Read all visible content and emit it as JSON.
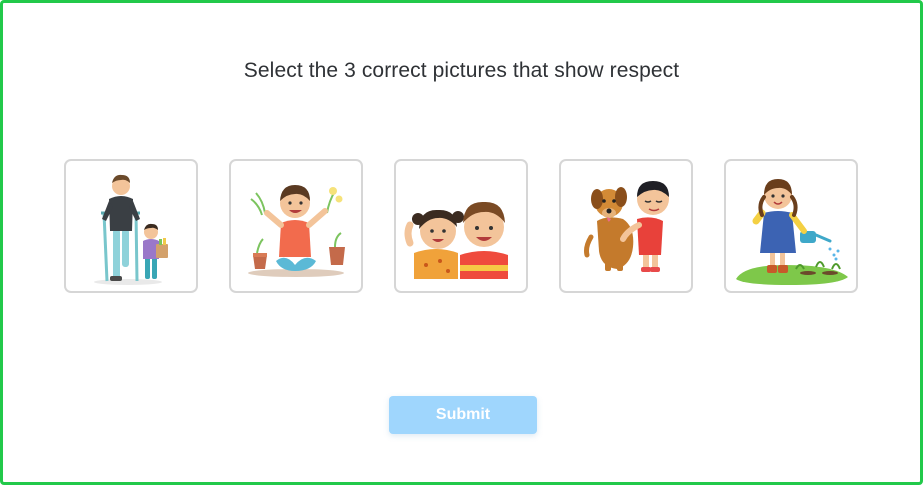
{
  "question": {
    "text": "Select the 3 correct pictures that show respect"
  },
  "choices": [
    {
      "id": "choice-1",
      "icon": "boy-helping-man-on-crutches-illustration"
    },
    {
      "id": "choice-2",
      "icon": "boy-pulling-up-plants-illustration"
    },
    {
      "id": "choice-3",
      "icon": "two-friends-smiling-illustration"
    },
    {
      "id": "choice-4",
      "icon": "boy-hugging-dog-illustration"
    },
    {
      "id": "choice-5",
      "icon": "girl-watering-plants-illustration"
    }
  ],
  "submit": {
    "label": "Submit",
    "color": "#9fd6fd"
  },
  "colors": {
    "frame_border": "#22c94a",
    "card_border": "#d6d6d6",
    "text": "#2f3236"
  }
}
